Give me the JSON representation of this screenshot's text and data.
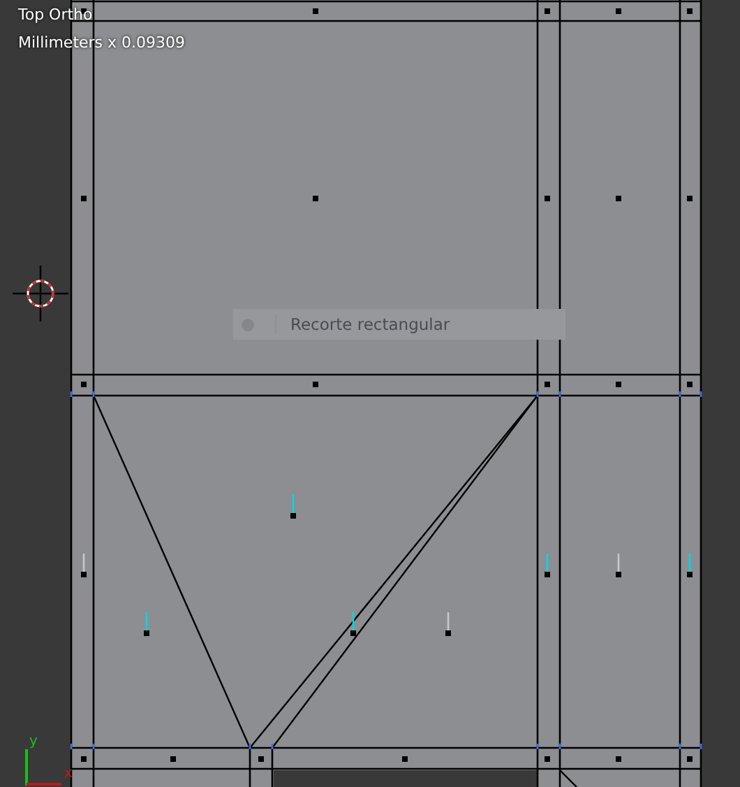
{
  "viewport": {
    "view_name": "Top Ortho",
    "units": "Millimeters x 0.09309"
  },
  "operator_panel": {
    "label": "Recorte rectangular"
  },
  "axis_gizmo": {
    "y_label": "y",
    "x_label": "x"
  }
}
